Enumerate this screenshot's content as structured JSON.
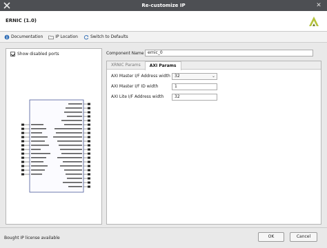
{
  "window": {
    "title": "Re-customize IP"
  },
  "header": {
    "ip_name": "ERNIC (1.0)"
  },
  "toolbar": {
    "documentation": "Documentation",
    "ip_location": "IP Location",
    "switch_defaults": "Switch to Defaults"
  },
  "left_panel": {
    "show_disabled_ports": "Show disabled ports",
    "show_disabled_checked": true
  },
  "component": {
    "label": "Component Name",
    "value": "ernic_0"
  },
  "tabs": [
    {
      "label": "XRNIC Params",
      "active": false
    },
    {
      "label": "AXI Params",
      "active": true
    }
  ],
  "axi_params": [
    {
      "label": "AXI Master I/F Address width",
      "value": "32",
      "kind": "select"
    },
    {
      "label": "AXI Master I/F ID width",
      "value": "1",
      "kind": "text"
    },
    {
      "label": "AXI Lite I/F Address width",
      "value": "32",
      "kind": "text"
    }
  ],
  "footer": {
    "license": "Bought IP license available",
    "ok": "OK",
    "cancel": "Cancel"
  },
  "colors": {
    "titlebar": "#4d4f53",
    "brand": "#b5c33c"
  }
}
